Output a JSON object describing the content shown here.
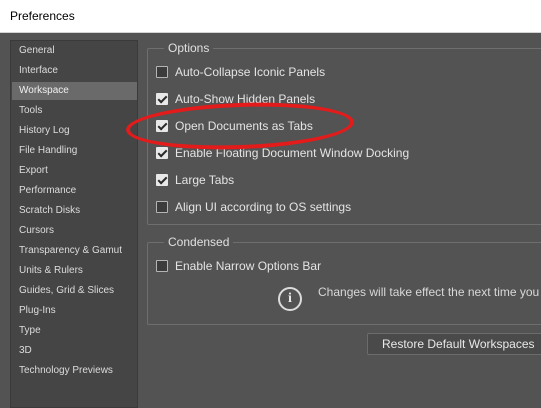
{
  "window": {
    "title": "Preferences"
  },
  "sidebar": {
    "items": [
      {
        "label": "General",
        "selected": false
      },
      {
        "label": "Interface",
        "selected": false
      },
      {
        "label": "Workspace",
        "selected": true
      },
      {
        "label": "Tools",
        "selected": false
      },
      {
        "label": "History Log",
        "selected": false
      },
      {
        "label": "File Handling",
        "selected": false
      },
      {
        "label": "Export",
        "selected": false
      },
      {
        "label": "Performance",
        "selected": false
      },
      {
        "label": "Scratch Disks",
        "selected": false
      },
      {
        "label": "Cursors",
        "selected": false
      },
      {
        "label": "Transparency & Gamut",
        "selected": false
      },
      {
        "label": "Units & Rulers",
        "selected": false
      },
      {
        "label": "Guides, Grid & Slices",
        "selected": false
      },
      {
        "label": "Plug-Ins",
        "selected": false
      },
      {
        "label": "Type",
        "selected": false
      },
      {
        "label": "3D",
        "selected": false
      },
      {
        "label": "Technology Previews",
        "selected": false
      }
    ]
  },
  "options": {
    "title": "Options",
    "checkboxes": [
      {
        "label": "Auto-Collapse Iconic Panels",
        "checked": false
      },
      {
        "label": "Auto-Show Hidden Panels",
        "checked": true
      },
      {
        "label": "Open Documents as Tabs",
        "checked": true
      },
      {
        "label": "Enable Floating Document Window Docking",
        "checked": true
      },
      {
        "label": "Large Tabs",
        "checked": true
      },
      {
        "label": "Align UI according to OS settings",
        "checked": false
      }
    ]
  },
  "condensed": {
    "title": "Condensed",
    "checkboxes": [
      {
        "label": "Enable Narrow Options Bar",
        "checked": false
      }
    ],
    "info_icon": "info-icon",
    "info_text": "Changes will take effect the next time you"
  },
  "buttons": {
    "restore_label": "Restore Default Workspaces"
  },
  "colors": {
    "annotation": "#e41b1b",
    "panel_bg": "#535353",
    "selected_item": "#6a6a6a"
  }
}
